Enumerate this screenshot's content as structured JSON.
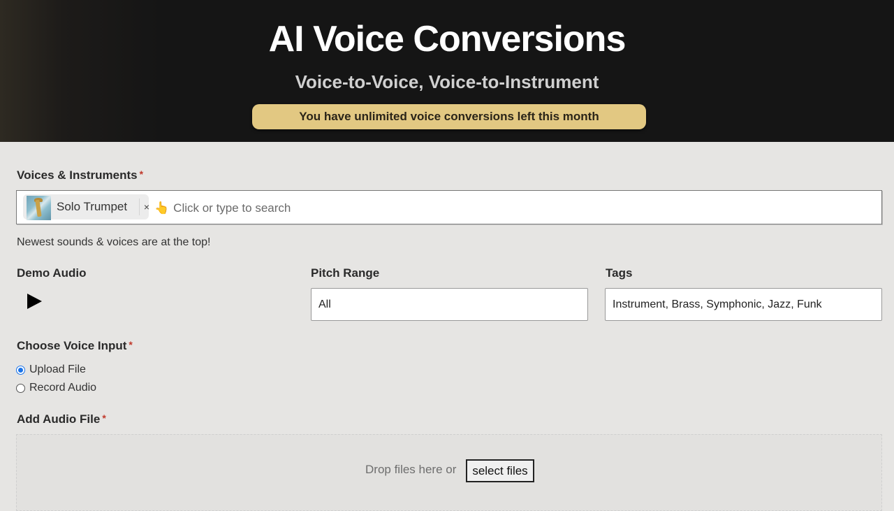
{
  "header": {
    "title": "AI Voice Conversions",
    "subtitle": "Voice-to-Voice, Voice-to-Instrument",
    "quota_banner": "You have unlimited voice conversions left this month",
    "banner_color": "#e2c882"
  },
  "voices": {
    "label": "Voices & Instruments",
    "required_mark": "*",
    "selected": [
      {
        "label": "Solo Trumpet",
        "remove": "×",
        "thumbnail": "trumpet-image"
      }
    ],
    "placeholder_icon": "👆",
    "placeholder": "Click or type to search",
    "help_text": "Newest sounds & voices are at the top!"
  },
  "demo_audio": {
    "label": "Demo Audio",
    "play_icon": "play-icon"
  },
  "pitch_range": {
    "label": "Pitch Range",
    "value": "All"
  },
  "tags": {
    "label": "Tags",
    "value": "Instrument, Brass, Symphonic, Jazz, Funk"
  },
  "voice_input": {
    "label": "Choose Voice Input",
    "required_mark": "*",
    "options": [
      {
        "label": "Upload File",
        "checked": true
      },
      {
        "label": "Record Audio",
        "checked": false
      }
    ],
    "accent_color": "#1a73e8"
  },
  "audio_file": {
    "label": "Add Audio File",
    "required_mark": "*",
    "drop_text": "Drop files here or",
    "select_button": "select files"
  }
}
